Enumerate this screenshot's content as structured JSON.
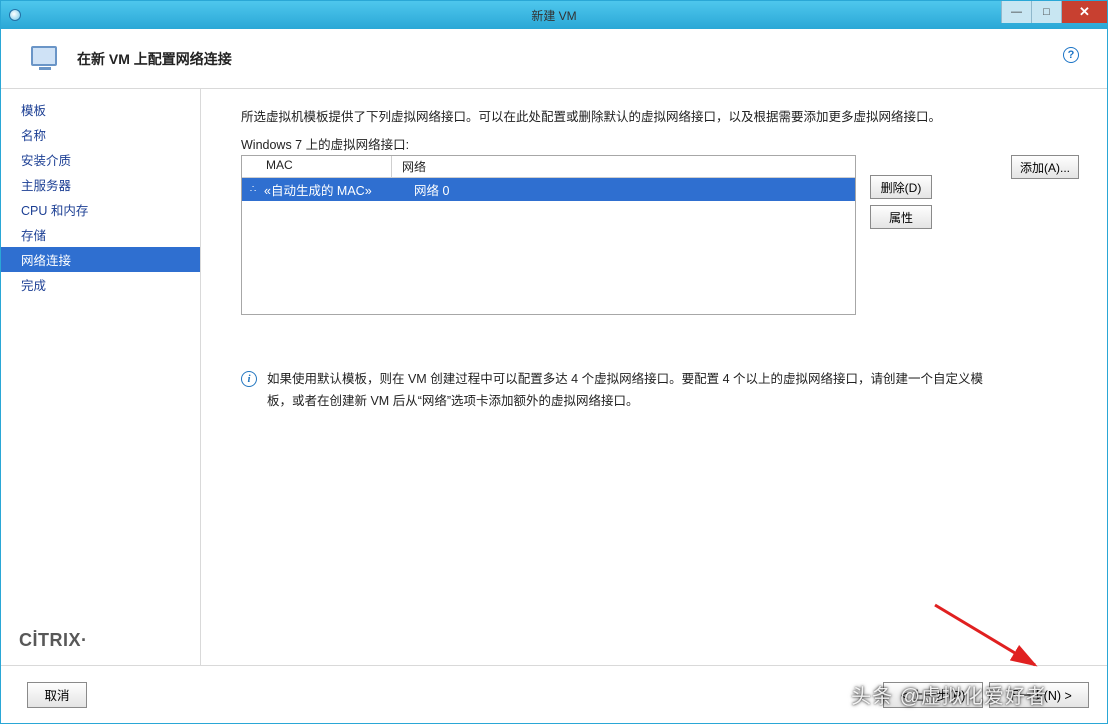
{
  "window": {
    "title": "新建 VM",
    "minimize_glyph": "—",
    "maximize_glyph": "□",
    "close_glyph": "✕"
  },
  "header": {
    "page_subtitle": "在新 VM 上配置网络连接",
    "help_glyph": "?"
  },
  "sidebar": {
    "steps": [
      {
        "label": "模板"
      },
      {
        "label": "名称"
      },
      {
        "label": "安装介质"
      },
      {
        "label": "主服务器"
      },
      {
        "label": "CPU 和内存"
      },
      {
        "label": "存储"
      },
      {
        "label": "网络连接",
        "active": true
      },
      {
        "label": "完成"
      }
    ],
    "brand": "CİTRIX",
    "brand_dot": "·"
  },
  "main": {
    "intro": "所选虚拟机模板提供了下列虚拟网络接口。可以在此处配置或删除默认的虚拟网络接口，以及根据需要添加更多虚拟网络接口。",
    "list_label": "Windows 7 上的虚拟网络接口:",
    "columns": {
      "c1": "MAC",
      "c2": "网络"
    },
    "row": {
      "mac": "«自动生成的 MAC»",
      "network": "网络 0"
    },
    "buttons": {
      "add": "添加(A)...",
      "delete": "删除(D)",
      "props": "属性"
    },
    "info_text": "如果使用默认模板，则在 VM 创建过程中可以配置多达 4 个虚拟网络接口。要配置 4 个以上的虚拟网络接口，请创建一个自定义模板，或者在创建新 VM 后从“网络”选项卡添加额外的虚拟网络接口。",
    "info_glyph": "i"
  },
  "footer": {
    "cancel": "取消",
    "prev": "< 上一步(P)",
    "next": "下一步(N) >"
  },
  "watermark": "头条 @虚拟化爱好者"
}
